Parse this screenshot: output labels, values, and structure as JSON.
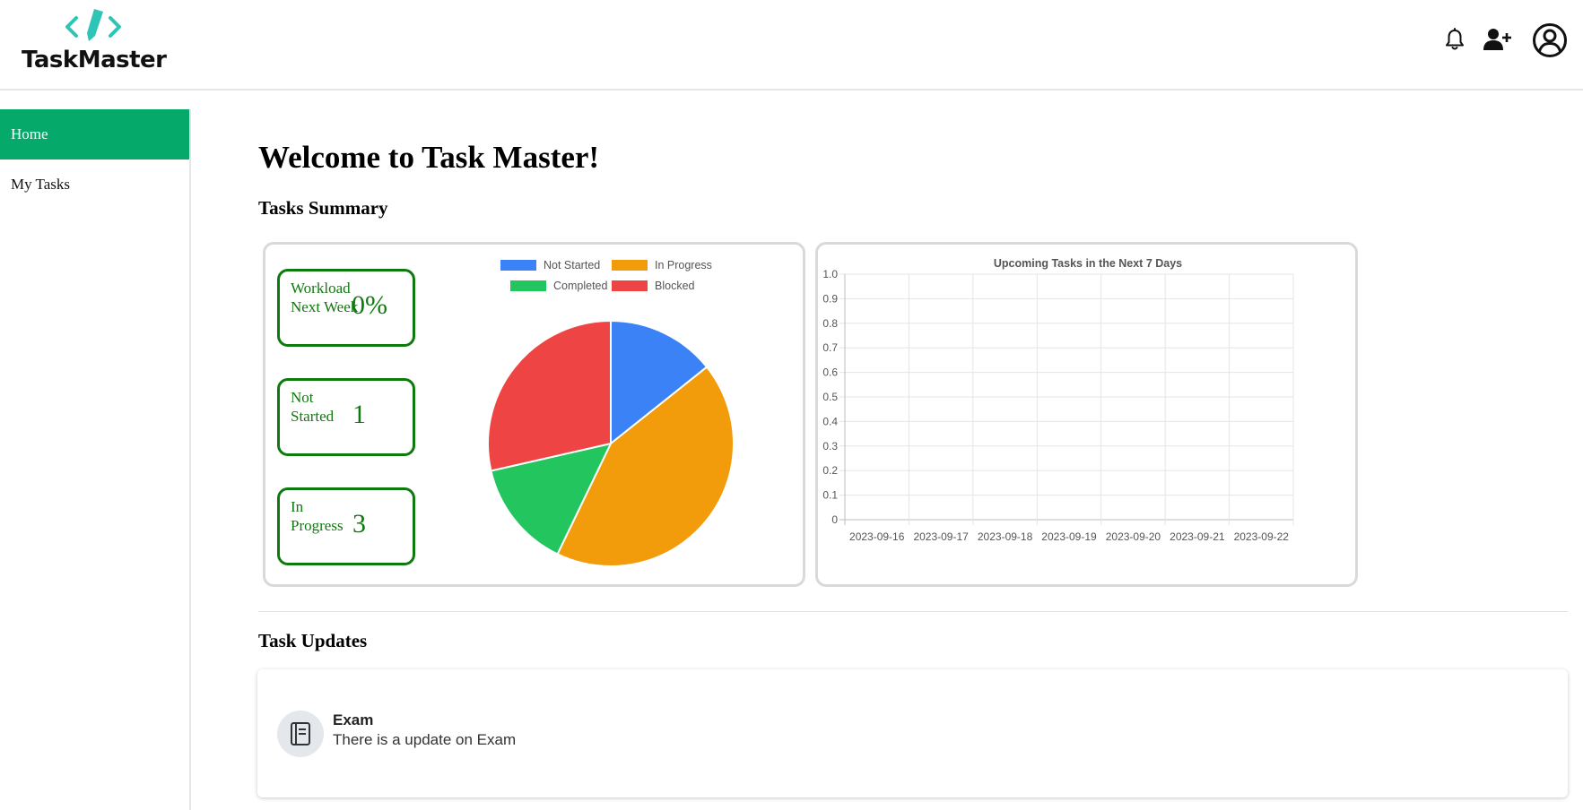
{
  "app": {
    "name": "TaskMaster",
    "brand_color": "#2ec5b6"
  },
  "header": {
    "icons": [
      "bell-icon",
      "add-user-icon",
      "profile-icon"
    ]
  },
  "sidebar": {
    "items": [
      {
        "label": "Home",
        "active": true
      },
      {
        "label": "My Tasks",
        "active": false
      }
    ],
    "active_color": "#05a96a"
  },
  "main": {
    "welcome": "Welcome to Task Master!",
    "summary_title": "Tasks Summary",
    "updates_title": "Task Updates"
  },
  "stats": [
    {
      "label": "Workload Next Week",
      "value": "0%"
    },
    {
      "label": "Not Started",
      "value": "1"
    },
    {
      "label": "In Progress",
      "value": "3"
    }
  ],
  "stat_color": "#0e7a0d",
  "chart_data": [
    {
      "type": "pie",
      "categories": [
        "Not Started",
        "In Progress",
        "Completed",
        "Blocked"
      ],
      "values": [
        1,
        3,
        1,
        2
      ],
      "colors": [
        "#3b82f6",
        "#f39c0b",
        "#22c55e",
        "#ef4444"
      ],
      "legend": "top"
    },
    {
      "type": "line",
      "title": "Upcoming Tasks in the Next 7 Days",
      "categories": [
        "2023-09-16",
        "2023-09-17",
        "2023-09-18",
        "2023-09-19",
        "2023-09-20",
        "2023-09-21",
        "2023-09-22"
      ],
      "values": [],
      "ylim": [
        0,
        1.0
      ],
      "yticks": [
        "1.0",
        "0.9",
        "0.8",
        "0.7",
        "0.6",
        "0.5",
        "0.4",
        "0.3",
        "0.2",
        "0.1",
        "0"
      ],
      "grid": true
    }
  ],
  "updates": [
    {
      "title": "Exam",
      "text": "There is a update on Exam",
      "icon": "book-icon"
    }
  ]
}
